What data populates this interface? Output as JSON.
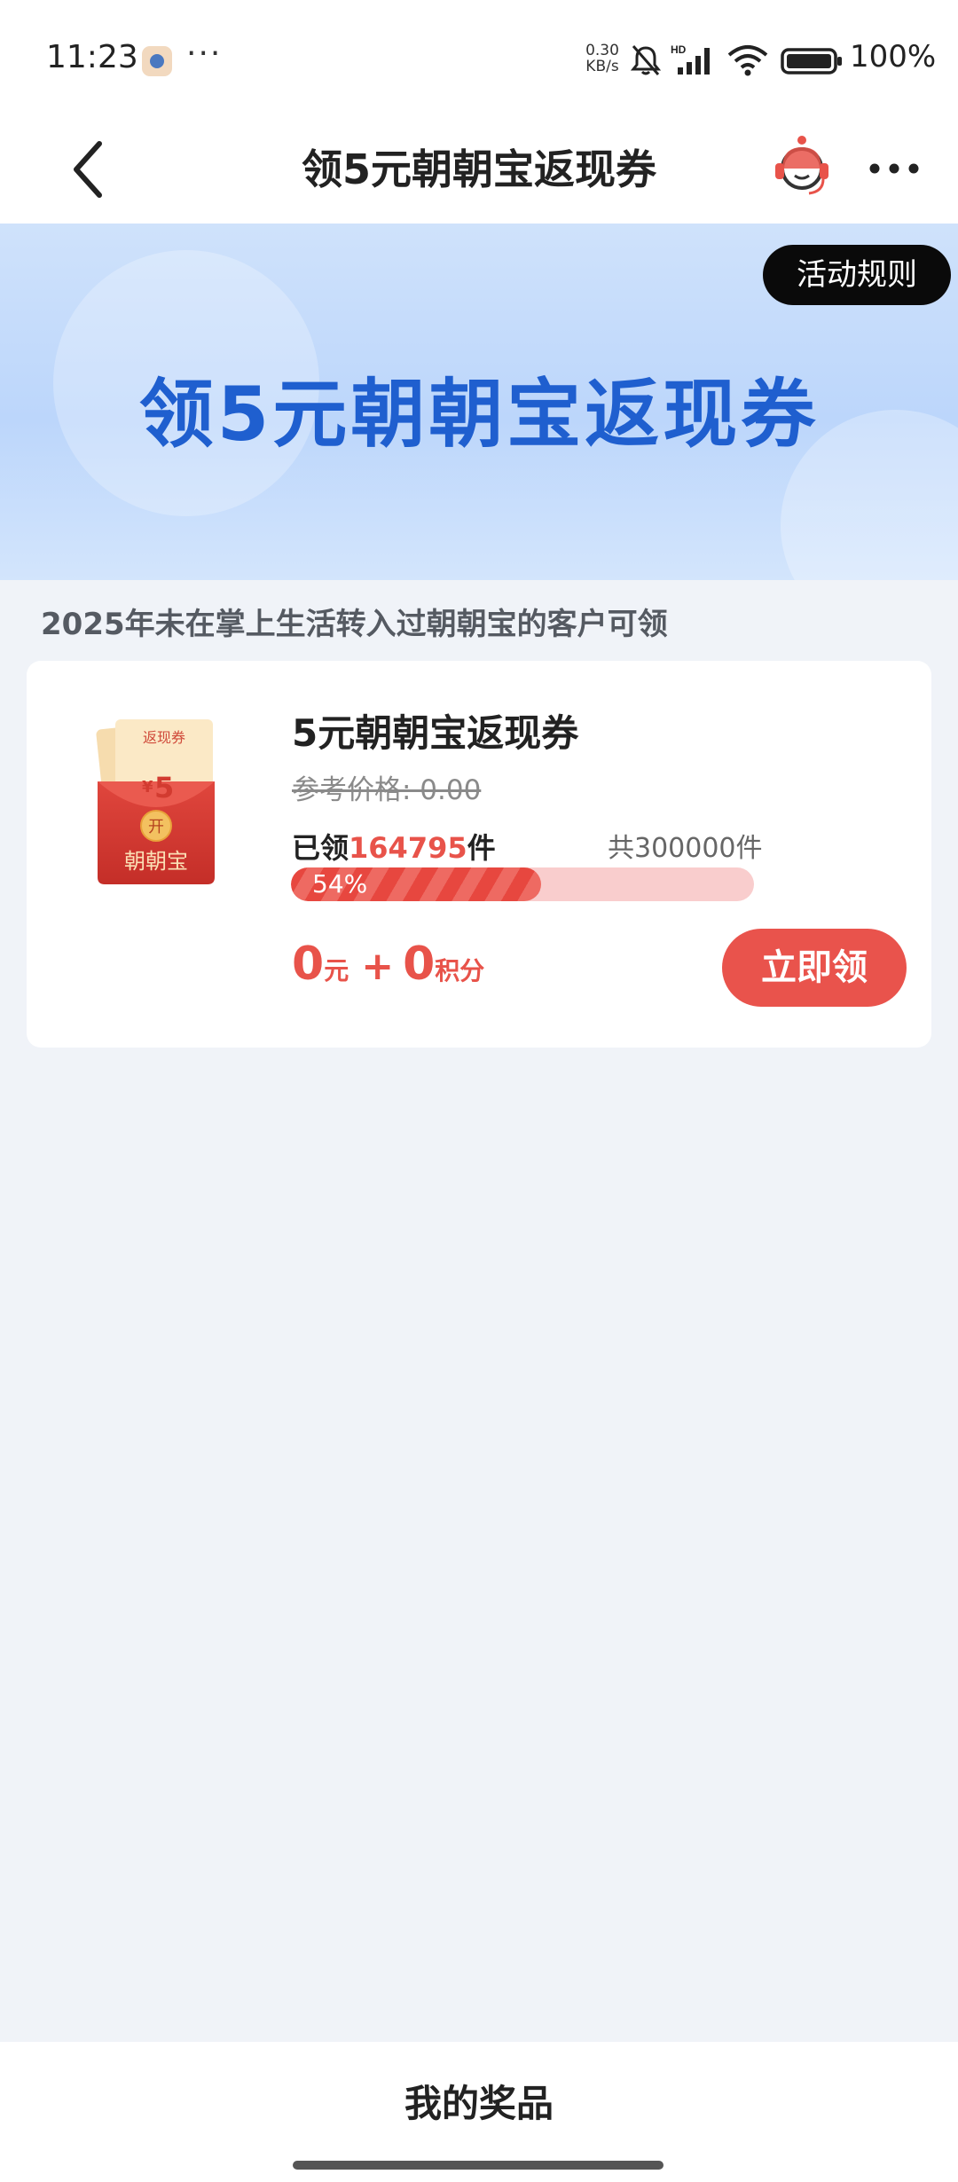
{
  "status_bar": {
    "time": "11:23",
    "more_dots": "···",
    "net_speed_value": "0.30",
    "net_speed_unit": "KB/s",
    "battery": "100%"
  },
  "nav": {
    "title": "领5元朝朝宝返现券"
  },
  "banner": {
    "title": "领5元朝朝宝返现券",
    "rules_button": "活动规则"
  },
  "eligibility_text": "2025年未在掌上生活转入过朝朝宝的客户可领",
  "product": {
    "image_badge": "返现券",
    "image_currency": "¥",
    "image_amount": "5",
    "image_open": "开",
    "image_brand": "朝朝宝",
    "title": "5元朝朝宝返现券",
    "reference_price": "参考价格: 0.00",
    "claimed_prefix": "已领",
    "claimed_count": "164795",
    "claimed_suffix": "件",
    "total": "共300000件",
    "progress_label": "54%",
    "progress_fraction": 0.54,
    "price_yuan": "0",
    "price_yuan_unit": "元",
    "price_plus": "+",
    "price_points": "0",
    "price_points_unit": "积分",
    "claim_button": "立即领"
  },
  "bottom": {
    "my_prizes": "我的奖品"
  },
  "colors": {
    "accent_red": "#e9534c",
    "banner_blue": "#1f5fcf",
    "page_bg": "#f0f3f8"
  }
}
